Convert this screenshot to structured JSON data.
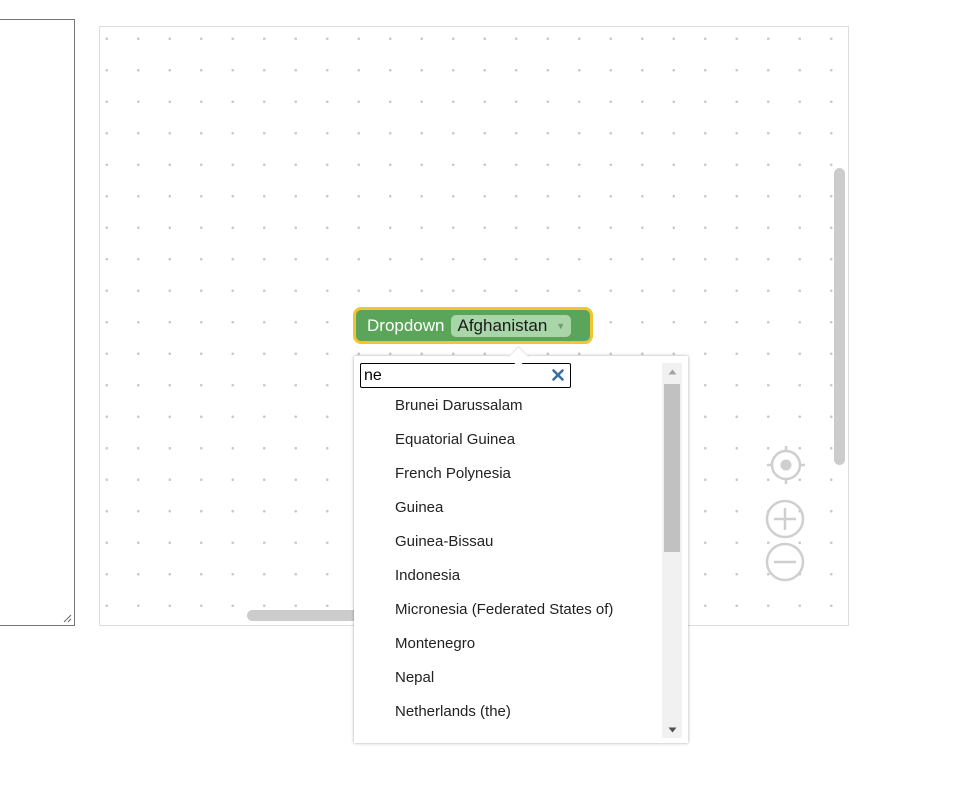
{
  "block": {
    "label": "Dropdown",
    "selected_value": "Afghanistan"
  },
  "dropdown": {
    "search_value": "ne",
    "options": [
      "Brunei Darussalam",
      "Equatorial Guinea",
      "French Polynesia",
      "Guinea",
      "Guinea-Bissau",
      "Indonesia",
      "Micronesia (Federated States of)",
      "Montenegro",
      "Nepal",
      "Netherlands (the)"
    ]
  },
  "icons": {
    "clear": "close-icon",
    "recenter": "target-icon",
    "zoom_in": "zoom-in-icon",
    "zoom_out": "zoom-out-icon",
    "dropdown_arrow": "triangle-down-icon",
    "scroll_up": "scroll-up-icon",
    "scroll_down": "scroll-down-icon",
    "resize": "resize-grip-icon"
  },
  "colors": {
    "block_fill": "#5ba55b",
    "block_outline": "#f4c430",
    "field_fill": "#a9d6a9",
    "clear_icon": "#3a6ea5"
  }
}
